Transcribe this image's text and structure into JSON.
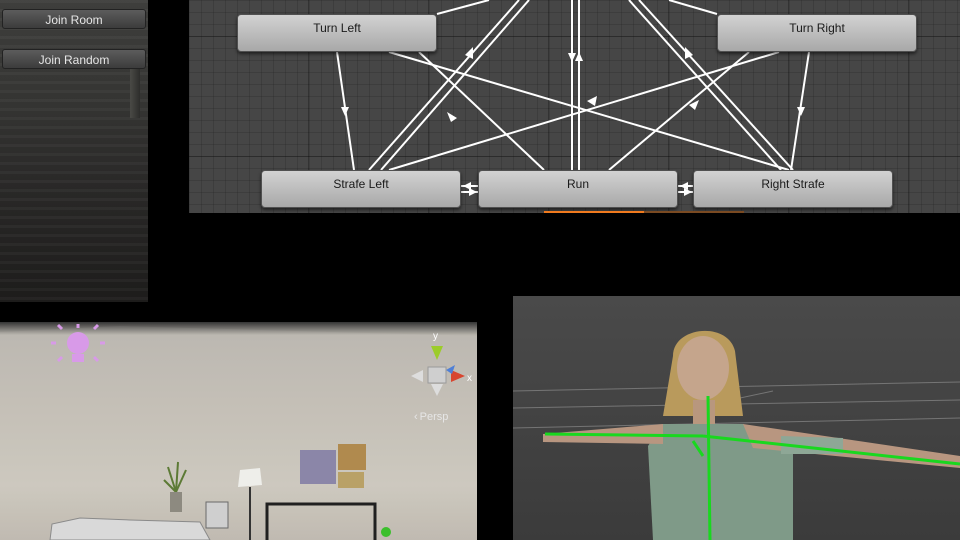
{
  "game_view": {
    "join_room_label": "Join Room",
    "join_random_label": "Join Random"
  },
  "animator": {
    "states": {
      "turn_left": "Turn Left",
      "turn_right": "Turn Right",
      "strafe_left": "Strafe Left",
      "run": "Run",
      "right_strafe": "Right Strafe"
    },
    "progress": 0.5
  },
  "scene_view": {
    "projection_label": "Persp",
    "gizmo_axes": {
      "y": "y",
      "x": "x"
    },
    "icons": [
      "directional-light-icon",
      "scene-orientation-gizmo"
    ],
    "colors": {
      "light": "#d89ae8",
      "x_axis": "#d8452f",
      "y_axis": "#9ccc2a",
      "z_axis": "#4f7fd6"
    }
  },
  "model_view": {
    "colors": {
      "bone": "#19d81f",
      "background": "#444444"
    }
  }
}
